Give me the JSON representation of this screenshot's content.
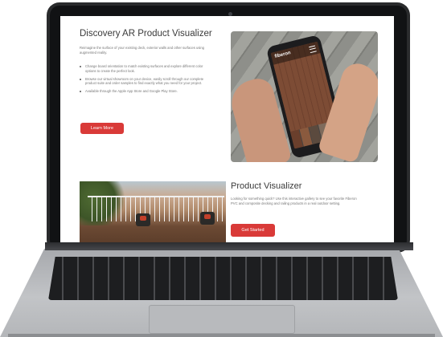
{
  "ar_section": {
    "title": "Discovery AR Product Visualizer",
    "intro": "Reimagine the surface of your existing deck, exterior walls and other surfaces using augmented reality.",
    "bullets": [
      "Change board orientation to match existing surfaces and explore different color options to create the perfect look.",
      "Browse our virtual showroom on your device, easily scroll through our complete product suite and order samples to find exactly what you need for your project.",
      "Available through the Apple App Store and Google Play Store."
    ],
    "button_label": "Learn More"
  },
  "phone_app": {
    "logo_text": "fiberon"
  },
  "visualizer_section": {
    "title": "Product Visualizer",
    "text": "Looking for something quick? Use this interactive gallery to see your favorite Fiberon PVC and composite decking and railing products in a real outdoor setting.",
    "button_label": "Get Started"
  },
  "colors": {
    "accent": "#d93a38",
    "laptop_bezel": "#2a2b2d",
    "laptop_body": "#b4b6b9"
  }
}
